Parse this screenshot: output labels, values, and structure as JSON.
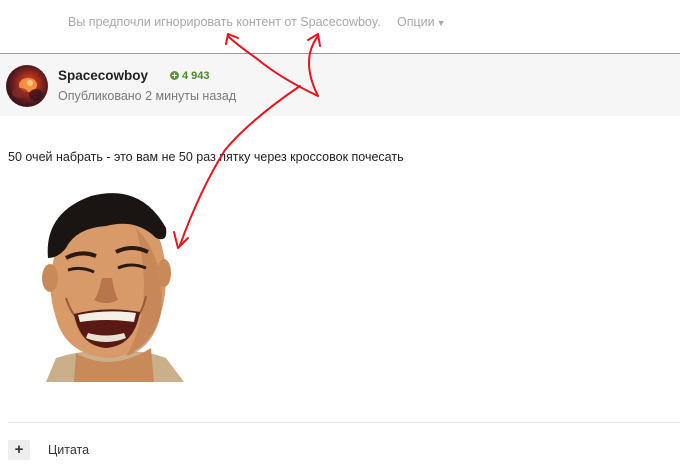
{
  "ignore_notice": {
    "text": "Вы предпочли игнорировать контент от Spacecowboy.",
    "options_label": "Опции",
    "caret_icon": "caret-down-icon"
  },
  "post": {
    "author": "Spacecowboy",
    "reputation": "4 943",
    "published": "Опубликовано 2 минуты назад",
    "body": "50 очей набрать - это вам не 50 раз пятку через кроссовок почесать"
  },
  "footer": {
    "quote_icon": "plus-icon",
    "quote_label": "Цитата"
  },
  "colors": {
    "annotation": "#e8141c",
    "reputation": "#4a8a2a",
    "header_bg": "#f6f6f6"
  }
}
